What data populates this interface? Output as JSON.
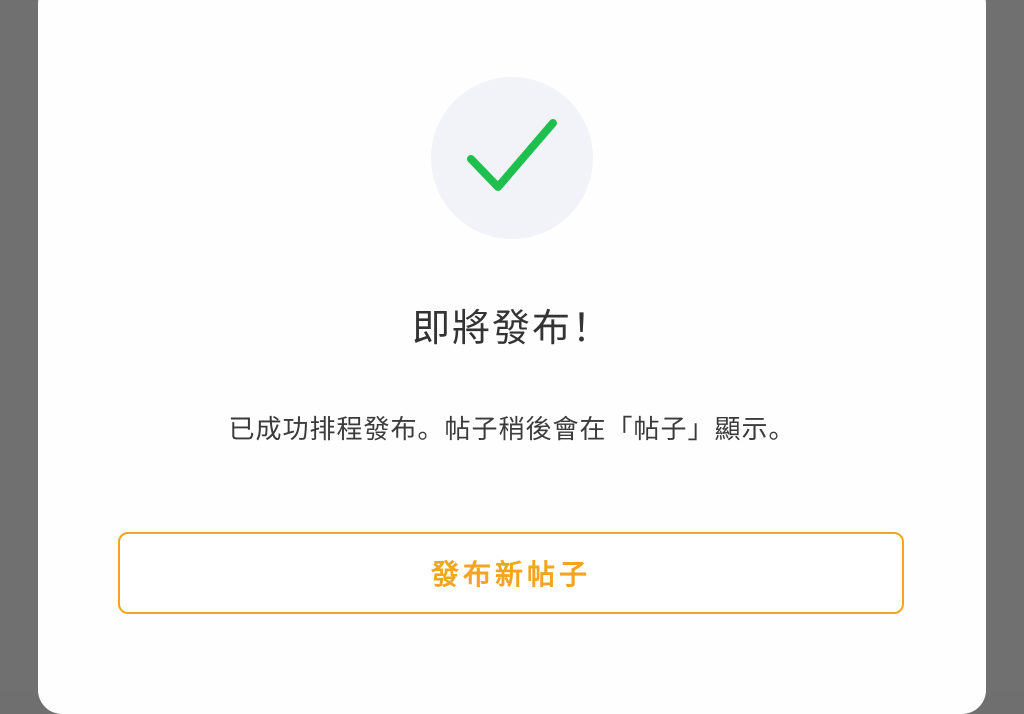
{
  "dialog": {
    "icon": "checkmark-icon",
    "title": "即將發布！",
    "message": "已成功排程發布。帖子稍後會在「帖子」顯示。",
    "button_label": "發布新帖子"
  },
  "colors": {
    "backdrop": "#707070",
    "modal_background": "#fefefe",
    "badge_background": "#f1f3f8",
    "success_green": "#1fbf4f",
    "accent_orange": "#f3a51f",
    "title_text": "#333333",
    "message_text": "#3b3b3b"
  }
}
